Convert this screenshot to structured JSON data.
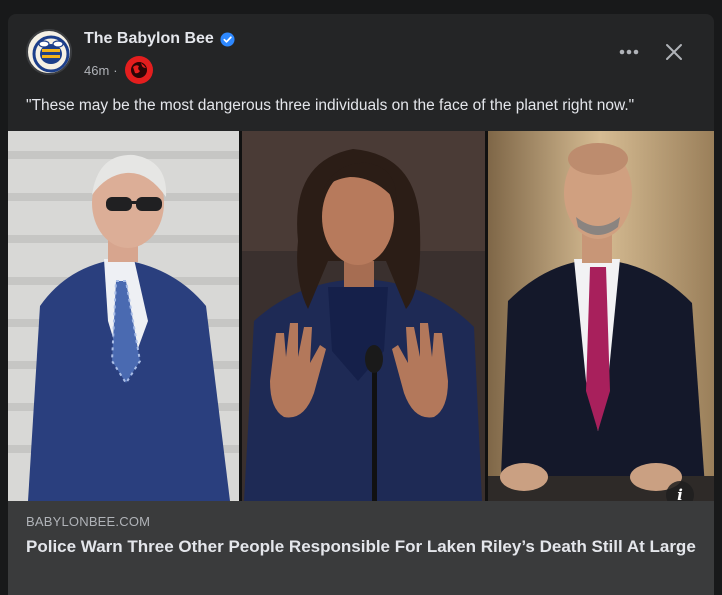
{
  "post": {
    "page_name": "The Babylon Bee",
    "timestamp": "46m",
    "separator": "·",
    "caption": "\"These may be the most dangerous three individuals on the face of the planet right now.\"",
    "link": {
      "domain": "BABYLONBEE.COM",
      "headline": "Police Warn Three Other People Responsible For Laken Riley’s Death Still At Large"
    }
  },
  "icons": {
    "avatar": "babylon-bee-logo",
    "verified": "verified-badge-icon",
    "audience": "globe-icon",
    "more": "more-options-icon",
    "close": "close-icon",
    "info": "info-icon"
  },
  "colors": {
    "background": "#18191a",
    "card": "#242526",
    "link_box": "#3a3b3c",
    "verified_blue": "#2d88ff",
    "text_primary": "#e4e6eb",
    "text_secondary": "#b0b3b8"
  }
}
